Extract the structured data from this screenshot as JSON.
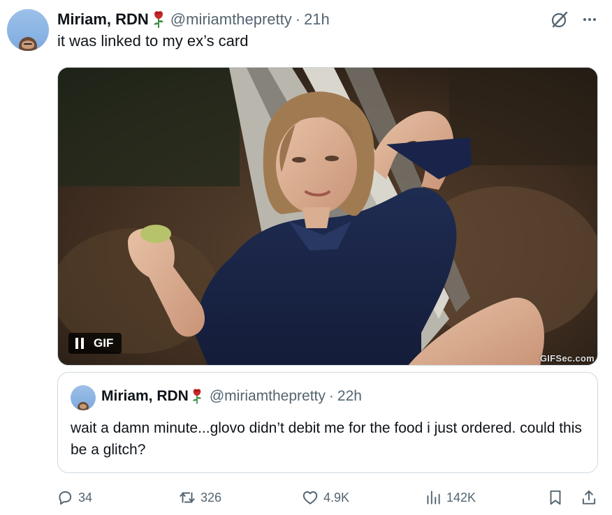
{
  "author": {
    "display_name": "Miriam, RDN",
    "handle": "@miriamthepretty",
    "separator": "·",
    "time": "21h",
    "emoji_icon": "rose-icon"
  },
  "tweet": {
    "text": "it was linked to my ex’s card"
  },
  "header_icons": [
    "grok-icon",
    "more-icon"
  ],
  "media": {
    "badge_label": "GIF",
    "badge_icon": "pause-icon",
    "watermark": "GIFSec.com"
  },
  "quote": {
    "display_name": "Miriam, RDN",
    "handle": "@miriamthepretty",
    "separator": "·",
    "time": "22h",
    "text": "wait a damn minute...glovo didn’t debit me for the food i just ordered. could this be a glitch?"
  },
  "actions": {
    "replies": "34",
    "reposts": "326",
    "likes": "4.9K",
    "views": "142K"
  },
  "colors": {
    "text_primary": "#0f1419",
    "text_secondary": "#536471",
    "border": "#cfd9de",
    "avatar_bg": "#8ab4e4"
  }
}
